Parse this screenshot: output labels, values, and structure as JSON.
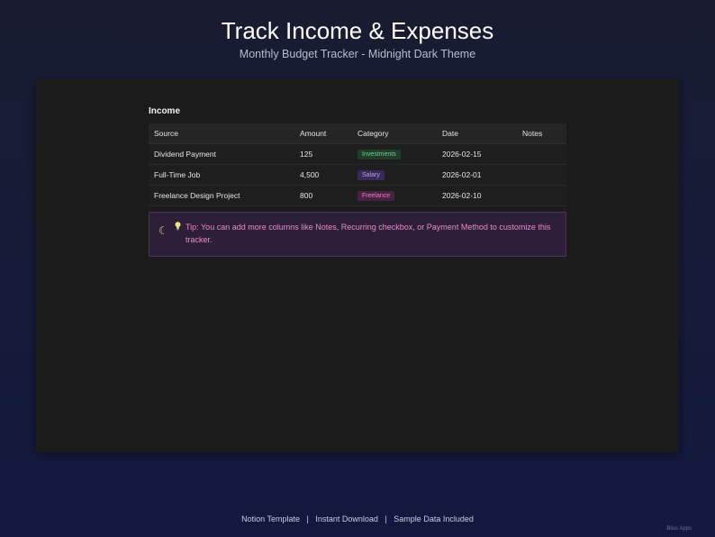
{
  "header": {
    "title": "Track Income & Expenses",
    "subtitle": "Monthly Budget Tracker - Midnight Dark Theme"
  },
  "income": {
    "section_title": "Income",
    "columns": [
      "Source",
      "Amount",
      "Category",
      "Date",
      "Notes"
    ],
    "rows": [
      {
        "source": "Dividend Payment",
        "amount": "125",
        "category": "Investments",
        "date": "2026-02-15",
        "notes": ""
      },
      {
        "source": "Full-Time Job",
        "amount": "4,500",
        "category": "Salary",
        "date": "2026-02-01",
        "notes": ""
      },
      {
        "source": "Freelance Design Project",
        "amount": "800",
        "category": "Freelance",
        "date": "2026-02-10",
        "notes": ""
      }
    ]
  },
  "tip": {
    "moon_icon": "crescent-moon-icon",
    "bulb_icon": "lightbulb-icon",
    "text": "Tip: You can add more columns like Notes, Recurring checkbox, or Payment Method to customize this tracker."
  },
  "footer": {
    "items": [
      "Notion Template",
      "Instant Download",
      "Sample Data Included"
    ],
    "separator": "|"
  },
  "watermark": "Bliss Apps",
  "colors": {
    "background": "#161b3a",
    "panel": "#1b1b1c",
    "tip_background": "#2e1f38",
    "tip_text": "#e58ad0",
    "tag_investments": "#6fd08c",
    "tag_salary": "#b49cf0",
    "tag_freelance": "#e784c4"
  }
}
